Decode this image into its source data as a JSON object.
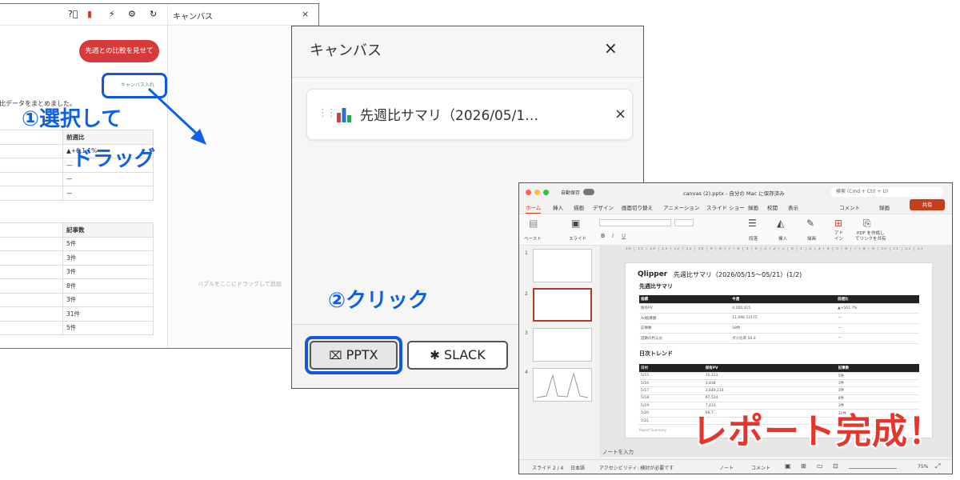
{
  "app": {
    "canvas_title": "キャンバス",
    "close_glyph": "×",
    "compare_button": "先週との比較を見せて",
    "canvas_in_button": "キャンバス入れ",
    "summary_text": "比データをまとめました。",
    "drop_hint": "バブルをここにドラッグして追加",
    "table1": {
      "header": "前週比",
      "rows": [
        "▲+6,1.1%",
        "—",
        "—",
        "—"
      ]
    },
    "table2": {
      "header": "記事数",
      "rows": [
        "5件",
        "3件",
        "3件",
        "8件",
        "3件",
        "31件",
        "5件"
      ]
    },
    "icons": [
      "help-icon",
      "red-flag-icon",
      "bolt-icon",
      "settings-icon",
      "refresh-icon"
    ]
  },
  "annotations": {
    "step1_select": "①選択して",
    "step1_drag": "ドラッグ",
    "step2_click": "②クリック",
    "result": "レポート完成！"
  },
  "canvas_modal": {
    "title": "キャンバス",
    "close_glyph": "×",
    "bubble_text": "先週比サマリ（2026/05/1…",
    "bubble_close": "×",
    "pptx_label": "PPTX",
    "slack_label": "SLACK"
  },
  "ppt": {
    "autosave": "自動保存",
    "file_title": "canvas (2).pptx - 自分の Mac に保存済み",
    "search_placeholder": "検索 (Cmd + Ctrl + U)",
    "menu": [
      "ホーム",
      "挿入",
      "描画",
      "デザイン",
      "画面切り替え",
      "アニメーション",
      "スライド ショー",
      "録画",
      "校閲",
      "表示"
    ],
    "comment_btn": "コメント",
    "record_btn": "録画",
    "share_btn": "共有",
    "ribbon": {
      "paste": "ペースト",
      "slide": "スライド",
      "paragraph": "段落",
      "insert": "挿入",
      "draw": "描画",
      "addin": "アド\nイン",
      "pdf": "PDF を作成し\nてリンクを共有"
    },
    "slide": {
      "logo": "Qlipper",
      "title": "先週比サマリ（2026/05/15〜05/21）(1/2)",
      "section1": "先週比サマリ",
      "table1_header": [
        "指標",
        "今週",
        "前週比"
      ],
      "table1_rows": [
        [
          "保有PV",
          "4,160,415",
          "▲+561.7%"
        ],
        [
          "Ad換算額",
          "11,094,52175",
          "—"
        ],
        [
          "記事数",
          "58件",
          "—"
        ],
        [
          "話題の判る分",
          "ポジ比率 50.0",
          "—"
        ]
      ],
      "section2": "日次トレンド",
      "table2_header": [
        "日付",
        "保有PV",
        "記事数"
      ],
      "table2_rows": [
        [
          "5/15",
          "10,311",
          "5件"
        ],
        [
          "5/16",
          "3,838",
          "3件"
        ],
        [
          "5/17",
          "3,649,214",
          "3件"
        ],
        [
          "5/18",
          "67,524",
          "8件"
        ],
        [
          "5/19",
          "7,433",
          "3件"
        ],
        [
          "5/20",
          "68,7…",
          "31件"
        ],
        [
          "5/21",
          "",
          "5件"
        ]
      ],
      "footer": "Report Summary"
    },
    "notes": "ノートを入力",
    "status": {
      "slide": "スライド 2 / 4",
      "lang": "日本語",
      "accessibility": "アクセシビリティ: 検討が必要です",
      "notes_btn": "ノート",
      "comments_btn": "コメント",
      "zoom": "75%"
    }
  }
}
